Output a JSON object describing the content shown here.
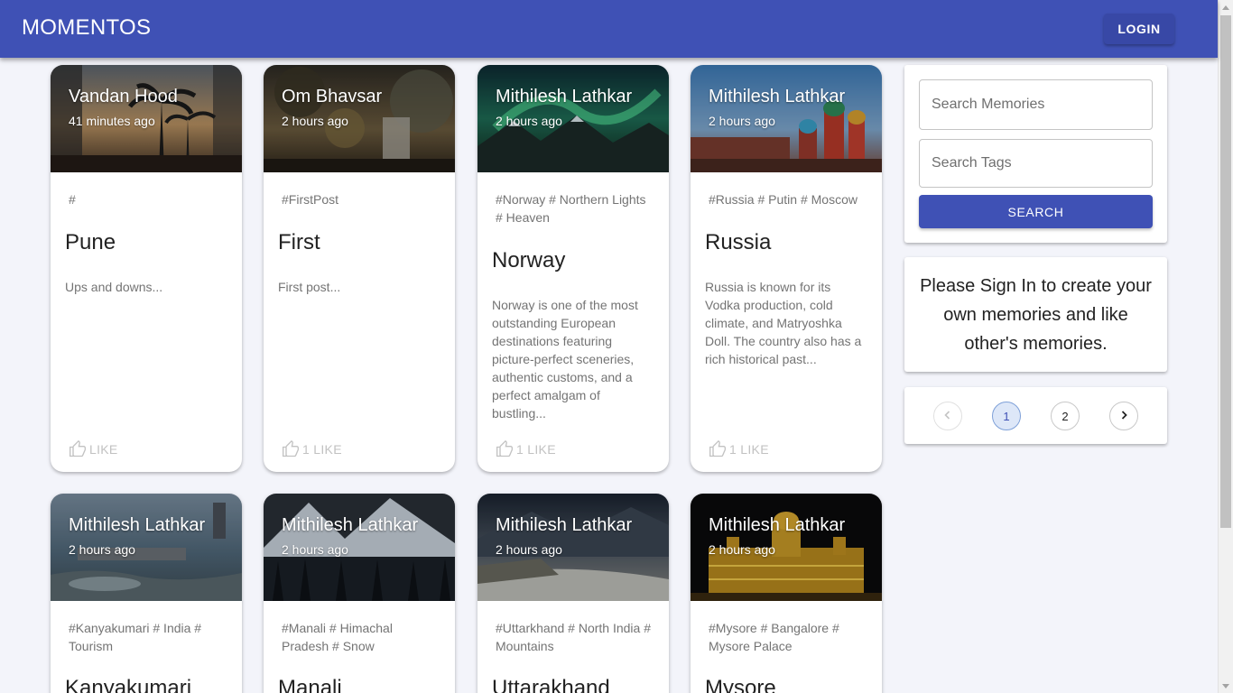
{
  "app": {
    "brand": "MOMENTOS",
    "login_label": "LOGIN"
  },
  "posts": [
    {
      "author": "Vandan Hood",
      "time": "41 minutes ago",
      "tags": "#",
      "title": "Pune",
      "message": "Ups and downs...",
      "like": "LIKE"
    },
    {
      "author": "Om Bhavsar",
      "time": "2 hours ago",
      "tags": "#FirstPost",
      "title": "First",
      "message": "First post...",
      "like": "1 LIKE"
    },
    {
      "author": "Mithilesh Lathkar",
      "time": "2 hours ago",
      "tags": "#Norway # Northern Lights # Heaven",
      "title": "Norway",
      "message": "Norway is one of the most outstanding European destinations featuring picture-perfect sceneries, authentic customs, and a perfect amalgam of bustling...",
      "like": "1 LIKE"
    },
    {
      "author": "Mithilesh Lathkar",
      "time": "2 hours ago",
      "tags": "#Russia # Putin # Moscow",
      "title": "Russia",
      "message": "Russia is known for its Vodka production, cold climate, and Matryoshka Doll. The country also has a rich historical past...",
      "like": "1 LIKE"
    },
    {
      "author": "Mithilesh Lathkar",
      "time": "2 hours ago",
      "tags": "#Kanyakumari # India # Tourism",
      "title": "Kanyakumari"
    },
    {
      "author": "Mithilesh Lathkar",
      "time": "2 hours ago",
      "tags": "#Manali # Himachal Pradesh # Snow",
      "title": "Manali"
    },
    {
      "author": "Mithilesh Lathkar",
      "time": "2 hours ago",
      "tags": "#Uttarkhand # North India # Mountains",
      "title": "Uttarakhand"
    },
    {
      "author": "Mithilesh Lathkar",
      "time": "2 hours ago",
      "tags": "#Mysore # Bangalore # Mysore Palace",
      "title": "Mysore"
    }
  ],
  "search": {
    "memories_placeholder": "Search Memories",
    "tags_placeholder": "Search Tags",
    "button_label": "SEARCH"
  },
  "signin_notice": "Please Sign In to create your own memories and like other's memories.",
  "pagination": {
    "current": "1",
    "next_page": "2",
    "prev_icon": "chevron-left-icon",
    "next_icon": "chevron-right-icon"
  },
  "colors": {
    "app_bar": "#3f51b5",
    "background": "#f3f4fa",
    "like_text": "#c2c2c2"
  }
}
